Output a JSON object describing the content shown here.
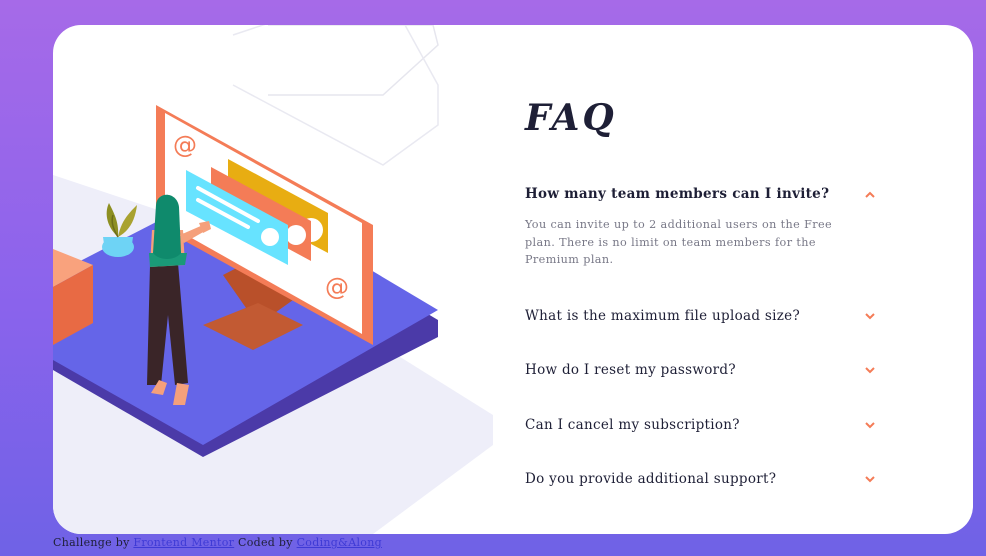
{
  "faq": {
    "title": "FAQ",
    "items": [
      {
        "question": "How many team members can I invite?",
        "answer": "You can invite up to 2 additional users on the Free plan. There is no limit on team members for the Premium plan.",
        "open": true
      },
      {
        "question": "What is the maximum file upload size?",
        "open": false
      },
      {
        "question": "How do I reset my password?",
        "open": false
      },
      {
        "question": "Can I cancel my subscription?",
        "open": false
      },
      {
        "question": "Do you provide additional support?",
        "open": false
      }
    ]
  },
  "footer": {
    "challenge_by": "Challenge by",
    "frontend_mentor": "Frontend Mentor",
    "coded_by": "Coded by",
    "author": "Coding&Along"
  },
  "colors": {
    "accent": "#f47c57",
    "heading": "#1e1f36",
    "body_text": "#787887",
    "platform": "#6464e6",
    "link": "#3e3ad6"
  }
}
